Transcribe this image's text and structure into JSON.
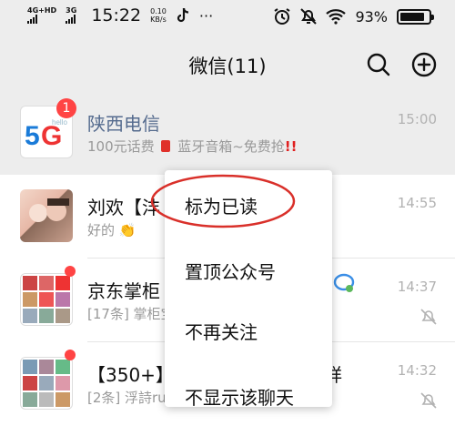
{
  "status_bar": {
    "network1": "4G+HD",
    "network2": "3G",
    "time": "15:22",
    "speed_value": "0.10",
    "speed_unit": "KB/s",
    "more": "···",
    "battery": "93%"
  },
  "header": {
    "title": "微信(11)",
    "search_icon": "search-icon",
    "add_icon": "plus-circle-icon"
  },
  "chats": [
    {
      "name": "陕西电信",
      "preview_text": "100元话费",
      "preview_mid": "蓝牙音箱~免费抢",
      "preview_tail": "!!",
      "time": "15:00",
      "badge": "1",
      "avatar_label": "5G",
      "avatar_sub": "hello"
    },
    {
      "name": "刘欢【沣",
      "preview_text": "好的",
      "time": "14:55"
    },
    {
      "name": "京东掌柜",
      "preview_text": "[17条] 掌柜宝",
      "time": "14:37"
    },
    {
      "name": "【350+】",
      "name_right": "祥",
      "preview_text": "[2条] 浮詩ru",
      "time": "14:32"
    }
  ],
  "context_menu": {
    "items": [
      "标为已读",
      "置顶公众号",
      "不再关注",
      "不显示该聊天"
    ]
  },
  "colors": {
    "badge": "#ff4444",
    "highlight_ellipse": "#d9302a",
    "official_name": "#556b8e"
  }
}
